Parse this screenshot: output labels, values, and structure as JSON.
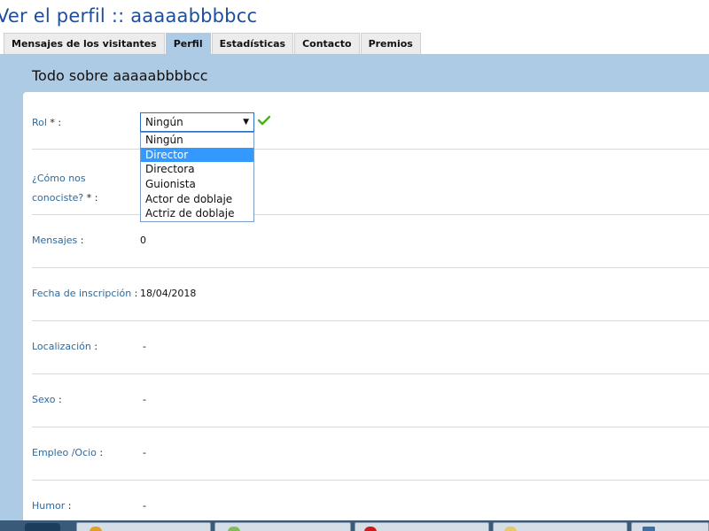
{
  "page": {
    "title": "Ver el perfil :: aaaaabbbbcc"
  },
  "tabs": [
    {
      "label": "Mensajes de los visitantes",
      "active": false
    },
    {
      "label": "Perfil",
      "active": true
    },
    {
      "label": "Estadísticas",
      "active": false
    },
    {
      "label": "Contacto",
      "active": false
    },
    {
      "label": "Premios",
      "active": false
    }
  ],
  "section": {
    "title": "Todo sobre aaaaabbbbcc"
  },
  "form": {
    "rol": {
      "label": "Rol",
      "required_mark": " * :",
      "selected_value": "Ningún",
      "arrow_icon": "▼",
      "valid_icon": "check-icon",
      "options": [
        "Ningún",
        "Director",
        "Directora",
        "Guionista",
        "Actor de doblaje",
        "Actriz de doblaje"
      ],
      "highlighted_option": "Director"
    },
    "como_nos_conociste": {
      "label_line1": "¿Cómo nos",
      "label_line2": "conociste?",
      "required_mark": " * :"
    }
  },
  "fields": [
    {
      "label": "Mensajes",
      "suffix": " :",
      "value": "0"
    },
    {
      "label": "Fecha de inscripción",
      "suffix": " :",
      "value": "18/04/2018"
    },
    {
      "label": "Localización",
      "suffix": " :",
      "value": "-"
    },
    {
      "label": "Sexo",
      "suffix": " :",
      "value": "-"
    },
    {
      "label": "Empleo /Ocio",
      "suffix": " :",
      "value": "-"
    },
    {
      "label": "Humor",
      "suffix": " :",
      "value": "-"
    }
  ],
  "colors": {
    "title": "#1f4e9a",
    "band": "#aecbe6",
    "label": "#2b6aa0",
    "highlight": "#3399ff",
    "check": "#4caf1a"
  }
}
